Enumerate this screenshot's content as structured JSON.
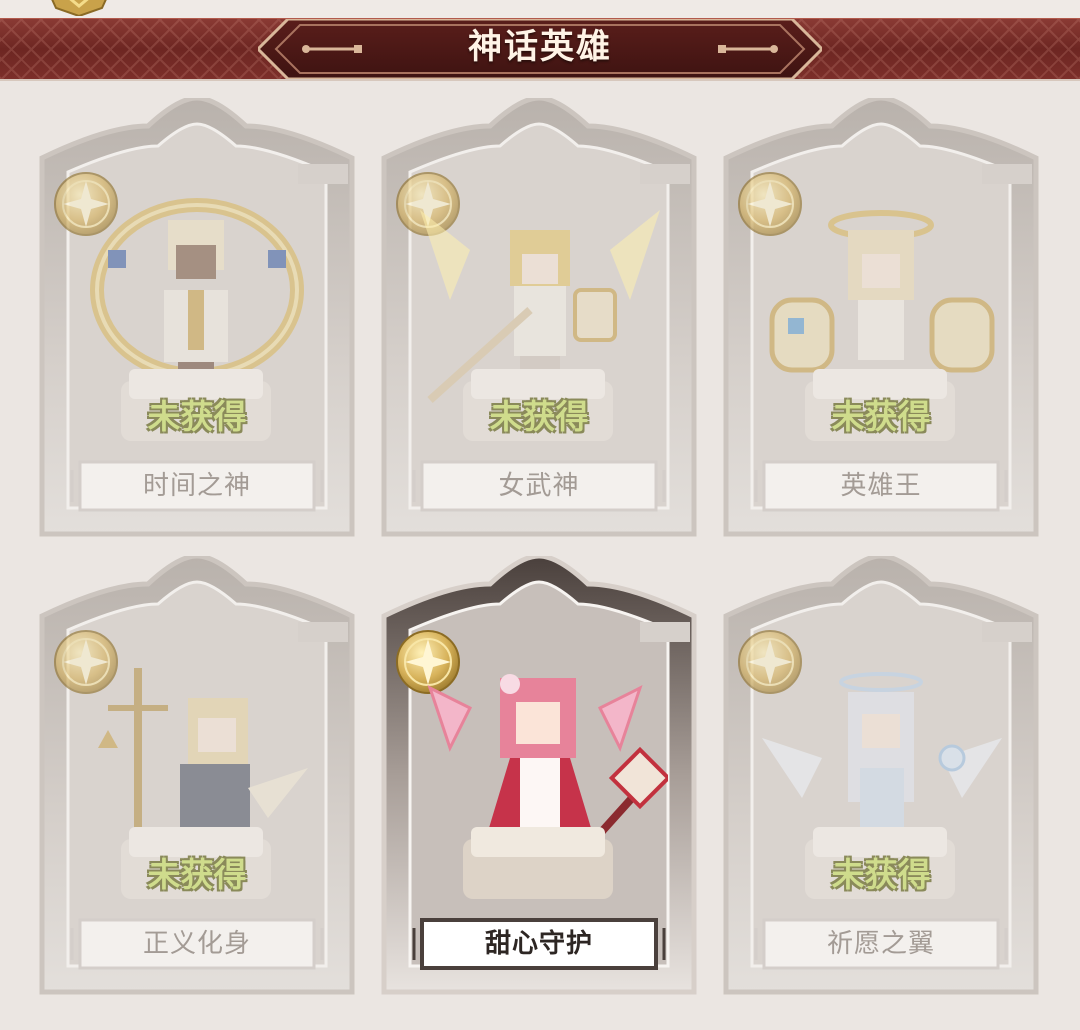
{
  "header": {
    "title": "神话英雄"
  },
  "heroes": [
    {
      "name": "时间之神",
      "status": "未获得",
      "owned": false
    },
    {
      "name": "女武神",
      "status": "未获得",
      "owned": false
    },
    {
      "name": "英雄王",
      "status": "未获得",
      "owned": false
    },
    {
      "name": "正义化身",
      "status": "未获得",
      "owned": false
    },
    {
      "name": "甜心守护",
      "status": "",
      "owned": true
    },
    {
      "name": "祈愿之翼",
      "status": "未获得",
      "owned": false
    }
  ],
  "colors": {
    "banner": "#7c2f2a",
    "background": "#ebe6e2",
    "status_text": "#cfdc8c",
    "name_locked": "#a39b95",
    "name_owned": "#2d2623",
    "gold": "#c9a24a",
    "pink": "#e7839a"
  },
  "icons": [
    "crown-badge-icon",
    "mythic-emblem-icon"
  ]
}
